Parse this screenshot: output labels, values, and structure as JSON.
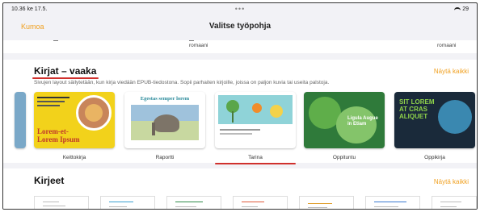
{
  "status_bar": {
    "time": "10.36 ke 17.5.",
    "battery": "29"
  },
  "nav": {
    "cancel": "Kumoa",
    "title": "Valitse työpohja"
  },
  "top_strip": {
    "left_label": "romaani",
    "right_label": "romaani"
  },
  "books_section": {
    "title": "Kirjat – vaaka",
    "show_all": "Näytä kaikki",
    "description": "Sivujen layout säilytetään, kun kirja viedään EPUB-tiedostona. Sopii parhaiten kirjoille, joissa on paljon kuvia tai useita palstoja.",
    "templates": [
      {
        "label": "Keittokirja",
        "cover_text": "Lorem-et-Lorem Ipsum"
      },
      {
        "label": "Raportti",
        "cover_text": "Egestas semper lorem"
      },
      {
        "label": "Tarina",
        "cover_text": ""
      },
      {
        "label": "Oppituntu",
        "cover_text": "Ligula Augue in Etiam"
      },
      {
        "label": "Oppikirja",
        "cover_text": "SIT LOREM AT CRAS ALIQUET"
      }
    ]
  },
  "letters_section": {
    "title": "Kirjeet",
    "show_all": "Näytä kaikki"
  },
  "colors": {
    "accent": "#f0a020",
    "underline_red": "#d0312d"
  }
}
